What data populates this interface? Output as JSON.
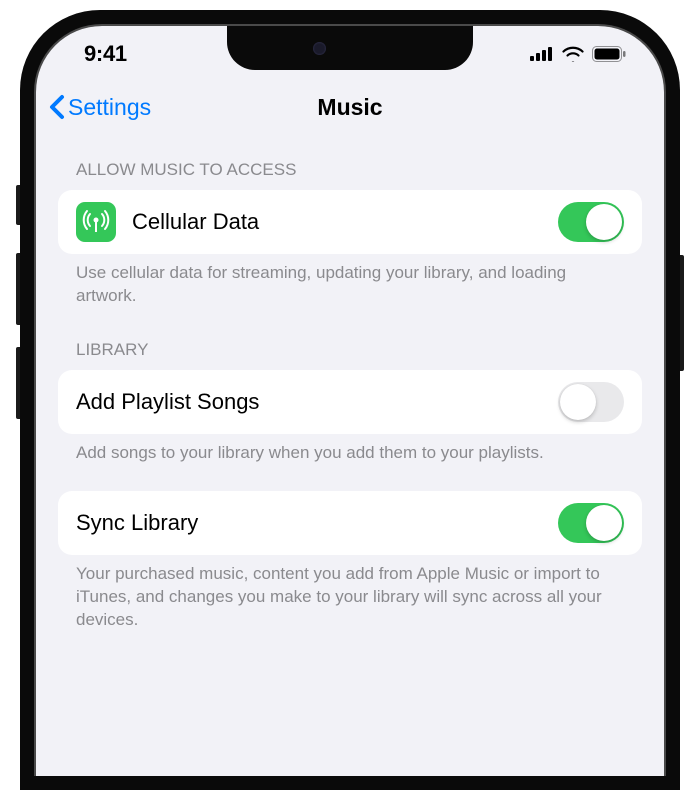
{
  "statusBar": {
    "time": "9:41"
  },
  "nav": {
    "back": "Settings",
    "title": "Music"
  },
  "sections": {
    "access": {
      "header": "ALLOW MUSIC TO ACCESS",
      "cellular": {
        "label": "Cellular Data",
        "on": true
      },
      "footer": "Use cellular data for streaming, updating your library, and loading artwork."
    },
    "library": {
      "header": "LIBRARY",
      "addPlaylist": {
        "label": "Add Playlist Songs",
        "on": false
      },
      "addPlaylistFooter": "Add songs to your library when you add them to your playlists.",
      "sync": {
        "label": "Sync Library",
        "on": true
      },
      "syncFooter": "Your purchased music, content you add from Apple Music or import to iTunes, and changes you make to your library will sync across all your devices."
    }
  },
  "colors": {
    "accent": "#007aff",
    "green": "#34c759",
    "bg": "#f2f2f7"
  }
}
